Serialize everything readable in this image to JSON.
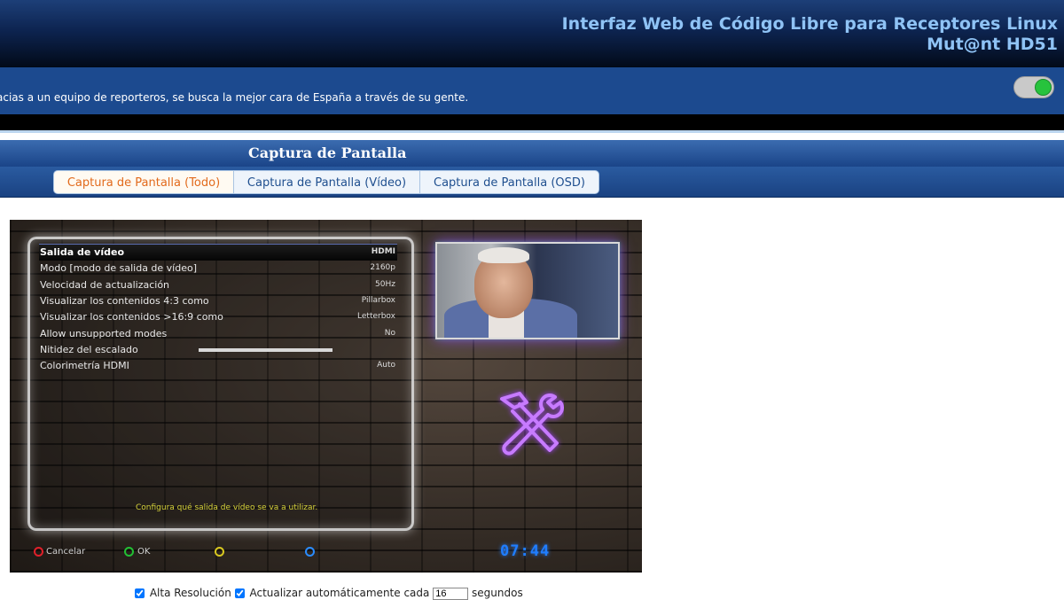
{
  "header": {
    "title_line1": "Interfaz Web de Código Libre para Receptores Linux",
    "title_line2": "Mut@nt HD51"
  },
  "ticker": {
    "text": "acias a un equipo de reporteros, se busca la mejor cara de España a través de su gente."
  },
  "toggle": {
    "state": "on",
    "color": "#27c33d"
  },
  "section": {
    "title": "Captura de Pantalla"
  },
  "tabs": [
    {
      "label": "Captura de Pantalla (Todo)",
      "active": true
    },
    {
      "label": "Captura de Pantalla (Vídeo)",
      "active": false
    },
    {
      "label": "Captura de Pantalla (OSD)",
      "active": false
    }
  ],
  "screenshot": {
    "menu": [
      {
        "label": "Salida de vídeo",
        "value": "HDMI",
        "selected": true
      },
      {
        "label": "Modo [modo de salida de vídeo]",
        "value": "2160p"
      },
      {
        "label": "Velocidad de actualización",
        "value": "50Hz"
      },
      {
        "label": "Visualizar los contenidos 4:3 como",
        "value": "Pillarbox"
      },
      {
        "label": "Visualizar los contenidos >16:9 como",
        "value": "Letterbox"
      },
      {
        "label": "Allow unsupported modes",
        "value": "No"
      },
      {
        "label": "Nitidez del escalado",
        "value": ""
      },
      {
        "label": "Colorimetría HDMI",
        "value": "Auto"
      }
    ],
    "help": "Configura qué salida de vídeo se va a utilizar.",
    "buttons": [
      {
        "label": "Cancelar",
        "color": "#e0202a"
      },
      {
        "label": "OK",
        "color": "#22c034"
      },
      {
        "label": "",
        "color": "#d8c820"
      },
      {
        "label": "",
        "color": "#2a8cff"
      }
    ],
    "clock": "07:44",
    "accent_colors": {
      "neon": "#b05bff",
      "clock": "#1f7dff"
    }
  },
  "controls": {
    "high_res_label": "Alta Resolución",
    "high_res_checked": true,
    "auto_refresh_label": "Actualizar automáticamente cada",
    "auto_refresh_checked": true,
    "interval_value": "16",
    "seconds_label": "segundos"
  }
}
